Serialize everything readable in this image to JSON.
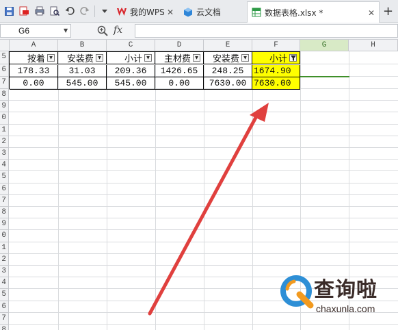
{
  "tabs": [
    {
      "label": "我的WPS",
      "closable": true,
      "active": false,
      "icon": "wps-logo-icon"
    },
    {
      "label": "云文档",
      "closable": false,
      "active": false,
      "icon": "cloud-docs-icon"
    },
    {
      "label": "数据表格.xlsx *",
      "closable": true,
      "active": true,
      "icon": "spreadsheet-icon"
    }
  ],
  "new_tab_label": "+",
  "close_glyph": "✕",
  "formula_bar": {
    "name_box": "G6",
    "fx_label": "fx",
    "formula": ""
  },
  "columns": [
    "A",
    "B",
    "C",
    "D",
    "E",
    "F",
    "G",
    "H"
  ],
  "selected_column": "G",
  "row_numbers": [
    "5",
    "6",
    "7",
    "8",
    "9",
    "0",
    "1",
    "2",
    "3",
    "4",
    "5",
    "6",
    "7",
    "8",
    "9",
    "0",
    "1",
    "2",
    "3",
    "4",
    "5",
    "6",
    "7",
    "8"
  ],
  "table": {
    "headers": [
      "按着",
      "安装费",
      "小计",
      "主材费",
      "安装费",
      "小计"
    ],
    "rows": [
      [
        "178.33",
        "31.03",
        "209.36",
        "1426.65",
        "248.25",
        "1674.90"
      ],
      [
        "0.00",
        "545.00",
        "545.00",
        "0.00",
        "7630.00",
        "7630.00"
      ]
    ]
  },
  "colors": {
    "highlight": "#ffff00",
    "arrow": "#e0403e",
    "selection": "#3f8f2a",
    "watermark_blue": "#2e8fd6",
    "watermark_orange": "#f29a1f"
  },
  "watermark": {
    "brand": "查询啦",
    "url": "chaxunla.com"
  }
}
